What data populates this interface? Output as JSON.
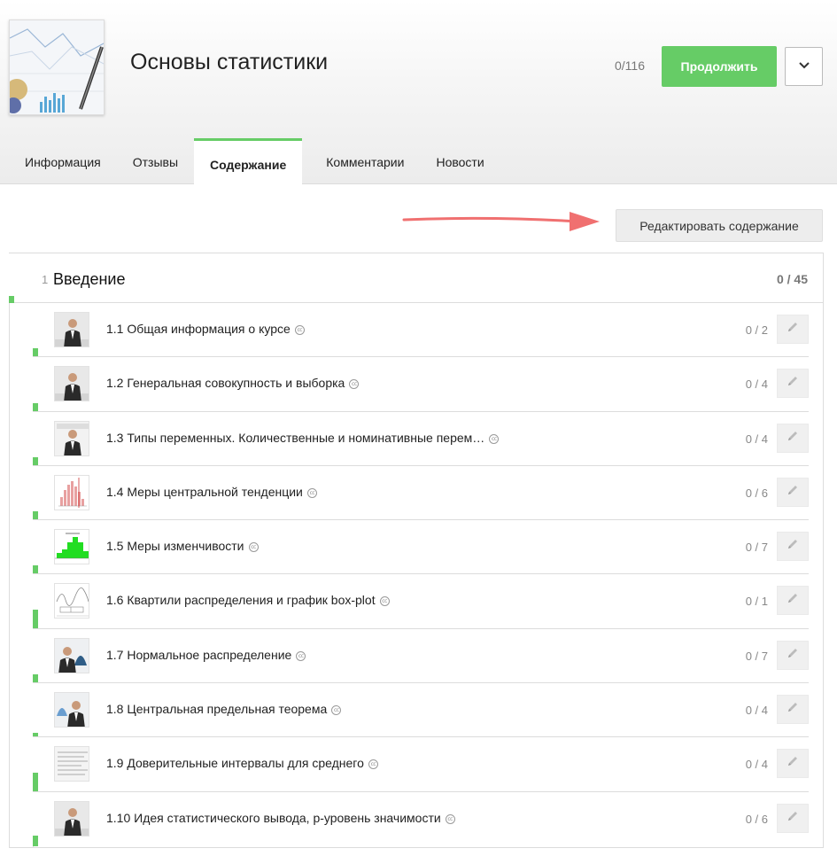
{
  "course": {
    "title": "Основы статистики",
    "progress": "0/116",
    "continue_label": "Продолжить"
  },
  "tabs": [
    {
      "label": "Информация"
    },
    {
      "label": "Отзывы"
    },
    {
      "label": "Содержание",
      "active": true
    },
    {
      "label": "Комментарии"
    },
    {
      "label": "Новости"
    }
  ],
  "edit_content_label": "Редактировать содержание",
  "section": {
    "number": "1",
    "title": "Введение",
    "progress": "0 / 45"
  },
  "lessons": [
    {
      "title": "1.1 Общая информация о курсе",
      "steps": "0 / 2",
      "thumb": "presenter",
      "progress_fraction": 0.15
    },
    {
      "title": "1.2 Генеральная совокупность и выборка",
      "steps": "0 / 4",
      "thumb": "presenter",
      "progress_fraction": 0.15
    },
    {
      "title": "1.3 Типы переменных. Количественные и номинативные перем…",
      "steps": "0 / 4",
      "thumb": "presenter-slide",
      "progress_fraction": 0.15
    },
    {
      "title": "1.4 Меры центральной тенденции",
      "steps": "0 / 6",
      "thumb": "histogram-red",
      "progress_fraction": 0.15
    },
    {
      "title": "1.5 Меры изменчивости",
      "steps": "0 / 7",
      "thumb": "histogram-green",
      "progress_fraction": 0.15
    },
    {
      "title": "1.6 Квартили распределения и график box-plot",
      "steps": "0 / 1",
      "thumb": "boxplot",
      "progress_fraction": 0.35
    },
    {
      "title": "1.7 Нормальное распределение",
      "steps": "0 / 7",
      "thumb": "presenter-normal",
      "progress_fraction": 0.15
    },
    {
      "title": "1.8 Центральная предельная теорема",
      "steps": "0 / 4",
      "thumb": "presenter-normal-left",
      "progress_fraction": 0.08
    },
    {
      "title": "1.9 Доверительные интервалы для среднего",
      "steps": "0 / 4",
      "thumb": "text-slide",
      "progress_fraction": 0.35
    },
    {
      "title": "1.10 Идея статистического вывода, p-уровень значимости",
      "steps": "0 / 6",
      "thumb": "presenter",
      "progress_fraction": 0.2
    }
  ],
  "icons": {
    "dropdown": "chevron-down-icon",
    "cc": "closed-captions-icon",
    "edit": "pencil-icon"
  },
  "colors": {
    "accent": "#66cc66",
    "annotation_arrow": "#f07070"
  }
}
